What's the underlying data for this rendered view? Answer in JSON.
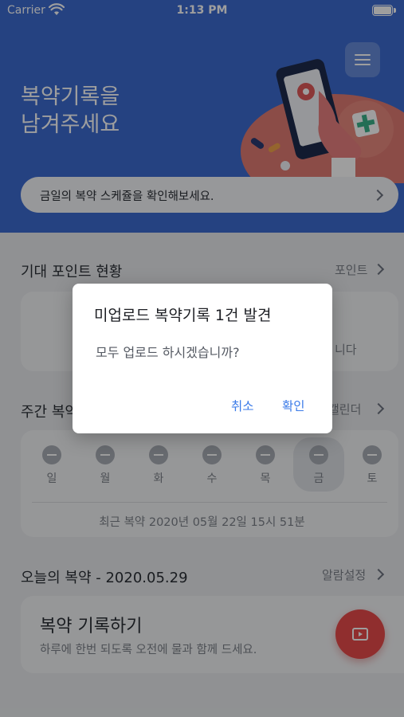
{
  "status_bar": {
    "carrier": "Carrier",
    "time": "1:13 PM"
  },
  "header": {
    "title_line1": "복약기록을",
    "title_line2": "남겨주세요",
    "schedule_banner": "금일의 복약 스케쥴을 확인해보세요."
  },
  "points": {
    "title": "기대 포인트 현황",
    "link": "포인트",
    "card_fragment": "니다"
  },
  "weekly": {
    "title_fragment": "주간 복약",
    "link_fragment": "캘린더",
    "days": [
      "일",
      "월",
      "화",
      "수",
      "목",
      "금",
      "토"
    ],
    "today_index": 5,
    "recent": "최근 복약 2020년 05월 22일 15시 51분"
  },
  "today": {
    "title": "오늘의 복약 - 2020.05.29",
    "link": "알람설정",
    "card_title": "복약 기록하기",
    "card_subtitle": "하루에 한번 되도록 오전에 물과 함께 드세요."
  },
  "dialog": {
    "title": "미업로드 복약기록 1건 발견",
    "message": "모두 업로드 하시겠습니까?",
    "cancel": "취소",
    "confirm": "확인"
  },
  "colors": {
    "brand_blue": "#3c6bd0",
    "accent_red": "#e84b4b",
    "dialog_button": "#3b7be8"
  },
  "icons": [
    "wifi-icon",
    "battery-icon",
    "menu-icon",
    "chevron-right-icon",
    "video-record-icon"
  ]
}
